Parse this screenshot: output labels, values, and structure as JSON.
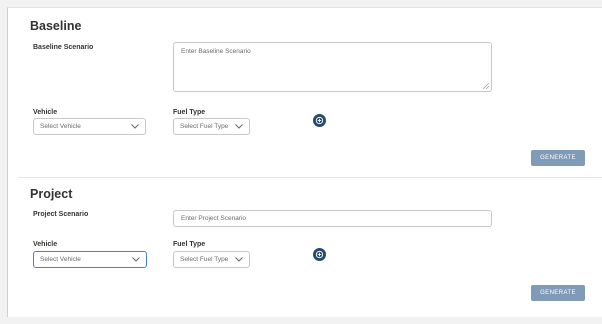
{
  "baseline": {
    "title": "Baseline",
    "scenario_label": "Baseline Scenario",
    "scenario_placeholder": "Enter Baseline Scenario",
    "vehicle_label": "Vehicle",
    "vehicle_value": "Select Vehicle",
    "fuel_label": "Fuel Type",
    "fuel_value": "Select Fuel Type",
    "generate_label": "GENERATE"
  },
  "project": {
    "title": "Project",
    "scenario_label": "Project Scenario",
    "scenario_placeholder": "Enter Project Scenario",
    "vehicle_label": "Vehicle",
    "vehicle_value": "Select Vehicle",
    "fuel_label": "Fuel Type",
    "fuel_value": "Select Fuel Type",
    "generate_label": "GENERATE"
  },
  "icons": {
    "add": "plus-circle-icon",
    "dropdown": "chevron-down-icon",
    "resize": "resize-grip-icon"
  },
  "colors": {
    "accent_dark": "#274a6c",
    "button_bg": "#7f9bb8",
    "focus_border": "#4d7fc7"
  }
}
